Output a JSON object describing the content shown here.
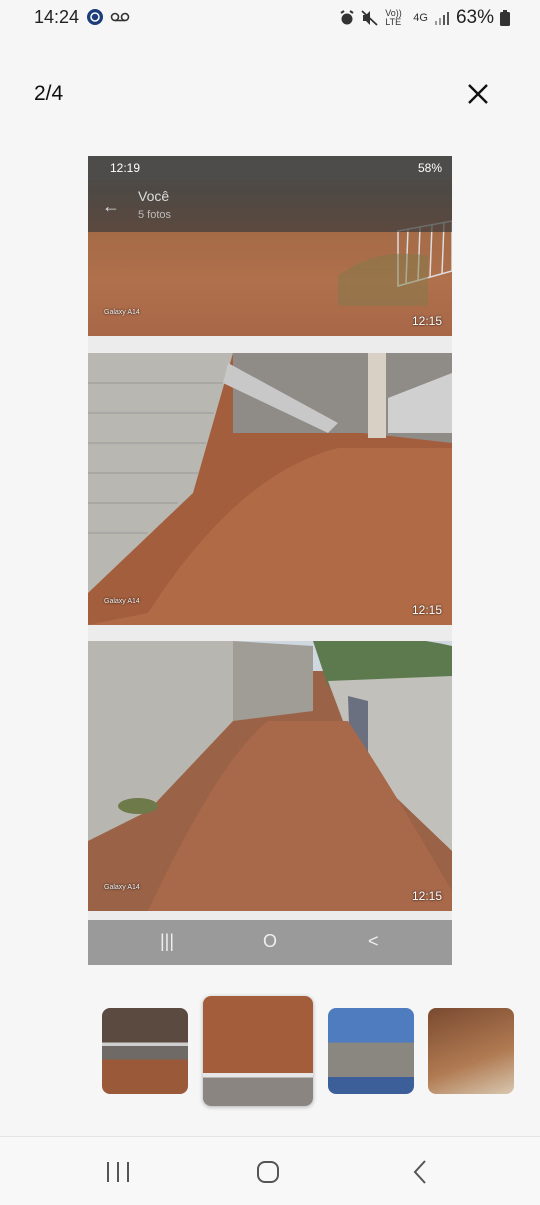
{
  "status_bar": {
    "time": "14:24",
    "icons": [
      "vpn-icon",
      "voicemail-icon",
      "alarm-icon",
      "mute-icon",
      "volte-icon",
      "4g-icon",
      "signal-icon",
      "battery-icon"
    ],
    "volte": "Vo)) LTE",
    "network": "4G",
    "battery": "63%"
  },
  "header": {
    "counter": "2/4",
    "close_icon": "close-icon"
  },
  "viewer": {
    "inner_status": {
      "time": "12:19",
      "battery": "58%"
    },
    "inner_appbar": {
      "title": "Você",
      "subtitle": "5 fotos"
    },
    "photos": [
      {
        "time": "12:15",
        "brand": "Galaxy A14"
      },
      {
        "time": "12:15",
        "brand": "Galaxy A14"
      },
      {
        "time": "12:15",
        "brand": "Galaxy A14"
      }
    ],
    "inner_nav": {
      "recents": "|||",
      "home": "O",
      "back": "<"
    }
  },
  "thumbnails": [
    {
      "name": "thumbnail-1",
      "selected": false
    },
    {
      "name": "thumbnail-2",
      "selected": true
    },
    {
      "name": "thumbnail-3",
      "selected": false
    },
    {
      "name": "thumbnail-4",
      "selected": false
    }
  ],
  "system_nav": {
    "recents_icon": "recents-icon",
    "home_icon": "home-icon",
    "back_icon": "back-icon"
  }
}
